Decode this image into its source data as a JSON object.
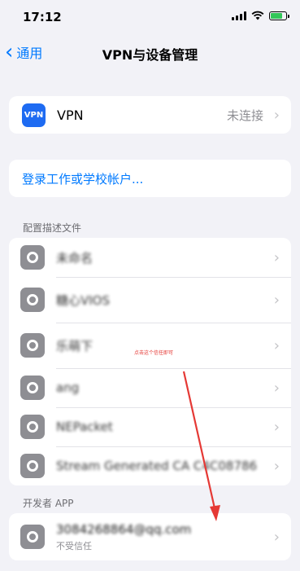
{
  "status_bar": {
    "time": "17:12",
    "icons": [
      "signal-icon",
      "wifi-icon",
      "battery-charging-icon"
    ]
  },
  "nav": {
    "back_label": "通用",
    "title": "VPN与设备管理"
  },
  "vpn": {
    "icon_text": "VPN",
    "label": "VPN",
    "status": "未连接"
  },
  "login": {
    "label": "登录工作或学校帐户..."
  },
  "profiles": {
    "header": "配置描述文件",
    "items": [
      {
        "name": "未命名"
      },
      {
        "name": "糖心VIOS"
      },
      {
        "name": "乐萌下"
      },
      {
        "name": "ang"
      },
      {
        "name": "NEPacket"
      },
      {
        "name": "Stream Generated CA C4C08786"
      }
    ]
  },
  "developer": {
    "header": "开发者 APP",
    "email": "3084268864@qq.com",
    "trust_status": "不受信任"
  },
  "annotation": {
    "note": "点击这个信任即可",
    "arrow_color": "#e53935"
  },
  "colors": {
    "accent": "#007aff",
    "background": "#f2f2f7",
    "gear_icon_bg": "#8e8e93",
    "vpn_icon_bg": "#1e6bf2"
  }
}
